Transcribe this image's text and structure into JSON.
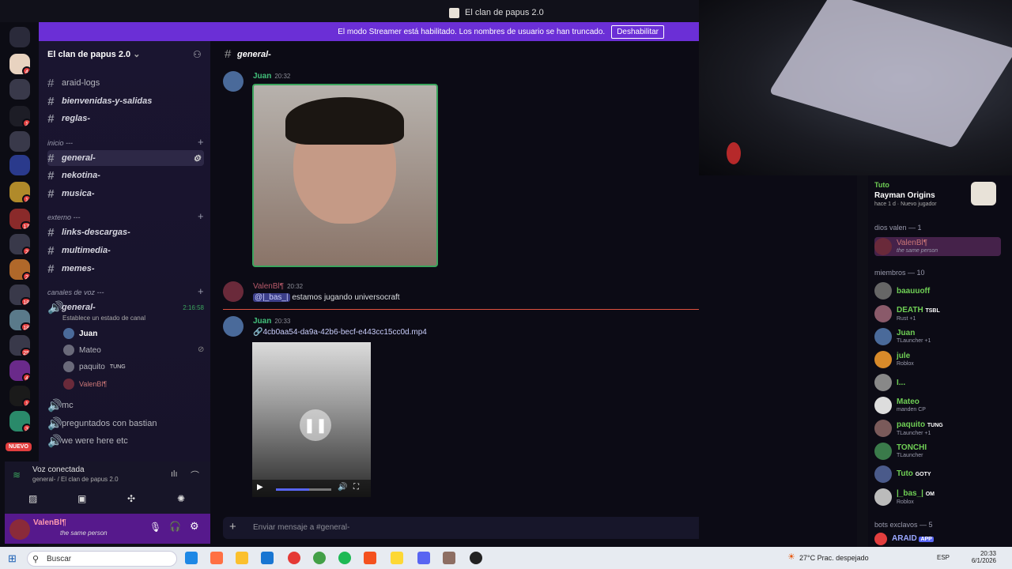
{
  "window": {
    "title": "El clan de papus 2.0"
  },
  "banner": {
    "text": "El modo Streamer está habilitado. Los nombres de usuario se han truncado.",
    "button": "Deshabilitar"
  },
  "server": {
    "name": "El clan de papus 2.0"
  },
  "channels_top": [
    "araid-logs",
    "bienvenidas-y-salidas",
    "reglas-"
  ],
  "category_inicio": "inicio ---",
  "channels_inicio": [
    "general-",
    "nekotina-",
    "musica-"
  ],
  "category_externo": "externo ---",
  "channels_externo": [
    "links-descargas-",
    "multimedia-",
    "memes-"
  ],
  "category_voz": "canales de voz ---",
  "voice_channel": {
    "name": "general-",
    "timer": "2:16:58",
    "status": "Establece un estado de canal"
  },
  "voice_users": [
    {
      "name": "Juan",
      "tag": ""
    },
    {
      "name": "Mateo",
      "tag": ""
    },
    {
      "name": "paquito",
      "tag": "TUNG"
    },
    {
      "name": "ValenBl¶",
      "tag": ""
    }
  ],
  "voice_channels_other": [
    "mc",
    "preguntados con bastian",
    "we were here etc"
  ],
  "voice_panel": {
    "title": "Voz conectada",
    "subtitle": "general- / El clan de papus 2.0"
  },
  "user_panel": {
    "name": "ValenBl¶",
    "status": "the same person"
  },
  "nuevo_badge": "NUEVO",
  "channel_header": "general-",
  "messages": [
    {
      "author": "Juan",
      "time": "20:32",
      "content": ""
    },
    {
      "author": "ValenBl¶",
      "time": "20:32",
      "mention": "@|_bas_|",
      "content": "estamos jugando universocraft"
    },
    {
      "author": "Juan",
      "time": "20:33",
      "content": "4cb0aa54-da9a-42b6-becf-e443cc15cc0d.mp4"
    }
  ],
  "composer": {
    "placeholder": "Enviar mensaje a #general-"
  },
  "activity": {
    "user": "Tuto",
    "game": "Rayman Origins",
    "meta": "hace 1 d",
    "tag": "Nuevo jugador"
  },
  "member_groups": [
    {
      "label": "dios valen — 1",
      "members": [
        {
          "name": "ValenBl¶",
          "status": "the same person"
        }
      ]
    },
    {
      "label": "miembros — 10",
      "members": [
        {
          "name": "baauuoff",
          "status": ""
        },
        {
          "name": "DEATH",
          "badge": "TSBL",
          "status": "Rust +1"
        },
        {
          "name": "Juan",
          "status": "TLauncher +1"
        },
        {
          "name": "jule",
          "status": "Roblox"
        },
        {
          "name": "I...",
          "status": ""
        },
        {
          "name": "Mateo",
          "status": "manden CP"
        },
        {
          "name": "paquito",
          "badge": "TUNG",
          "status": "TLauncher +1"
        },
        {
          "name": "TONCHI",
          "status": "TLauncher"
        },
        {
          "name": "Tuto",
          "badge": "GOTY",
          "status": ""
        },
        {
          "name": "|_bas_|",
          "badge": "OM",
          "status": "Roblox"
        }
      ]
    },
    {
      "label": "bots exclavos — 5",
      "members": [
        {
          "name": "ARAID",
          "badge": "APP",
          "status": ""
        }
      ]
    }
  ],
  "taskbar": {
    "search": "Buscar",
    "weather": "27°C",
    "weather_desc": "Prac. despejado",
    "lang": "ESP",
    "time": "20:33",
    "date": "6/1/2026"
  }
}
